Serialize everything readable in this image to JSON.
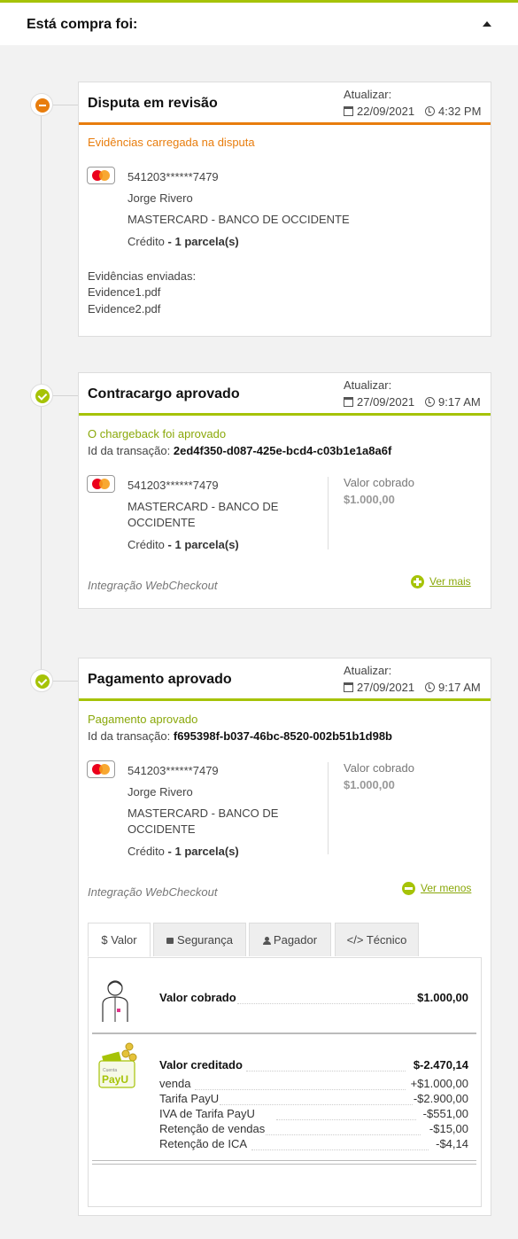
{
  "header": {
    "title": "Está compra foi:"
  },
  "colors": {
    "accent_green": "#a6c307",
    "accent_orange": "#e87d0d",
    "mastercard_red": "#eb001b",
    "mastercard_yellow": "#f79e1b"
  },
  "cards": [
    {
      "title": "Disputa em revisão",
      "status_icon": "minus-circle-icon",
      "update_label": "Atualizar:",
      "date": "22/09/2021",
      "time": "4:32 PM",
      "status": "Evidências carregada na disputa",
      "card_number": "541203******7479",
      "holder": "Jorge Rivero",
      "brand_bank": "MASTERCARD - BANCO DE OCCIDENTE",
      "credit_label": "Crédito",
      "installments": "- 1 parcela(s)",
      "evidence_label": "Evidências enviadas:",
      "evidence_files": [
        "Evidence1.pdf",
        "Evidence2.pdf"
      ]
    },
    {
      "title": "Contracargo aprovado",
      "status_icon": "check-circle-icon",
      "update_label": "Atualizar:",
      "date": "27/09/2021",
      "time": "9:17 AM",
      "status": "O chargeback foi aprovado",
      "tx_label": "Id da transação:",
      "tx_id": "2ed4f350-d087-425e-bcd4-c03b1e1a8a6f",
      "card_number": "541203******7479",
      "brand_bank_line1": "MASTERCARD - BANCO DE",
      "brand_bank_line2": "OCCIDENTE",
      "credit_label": "Crédito",
      "installments": "- 1 parcela(s)",
      "value_label": "Valor cobrado",
      "value": "$1.000,00",
      "integration": "Integração WebCheckout",
      "toggle": "Ver mais"
    },
    {
      "title": "Pagamento aprovado",
      "status_icon": "check-circle-icon",
      "update_label": "Atualizar:",
      "date": "27/09/2021",
      "time": "9:17 AM",
      "status": "Pagamento aprovado",
      "tx_label": "Id da transação:",
      "tx_id": "f695398f-b037-46bc-8520-002b51b1d98b",
      "card_number": "541203******7479",
      "holder": "Jorge Rivero",
      "brand_bank_line1": "MASTERCARD - BANCO DE",
      "brand_bank_line2": "OCCIDENTE",
      "credit_label": "Crédito",
      "installments": "- 1 parcela(s)",
      "value_label": "Valor cobrado",
      "value": "$1.000,00",
      "integration": "Integração WebCheckout",
      "toggle": "Ver menos",
      "tabs": [
        "$ Valor",
        "Segurança",
        "Pagador",
        "</> Técnico"
      ],
      "active_tab": "$ Valor",
      "charged": {
        "label": "Valor cobrado",
        "value": "$1.000,00"
      },
      "credited": {
        "label": "Valor creditado",
        "value": "$-2.470,14",
        "rows": [
          {
            "label": "venda",
            "value": "+$1.000,00"
          },
          {
            "label": "Tarifa PayU",
            "value": "-$2.900,00"
          },
          {
            "label": "IVA de Tarifa PayU",
            "value": "-$551,00"
          },
          {
            "label": "Retenção de vendas",
            "value": "-$15,00"
          },
          {
            "label": "Retenção de ICA",
            "value": "-$4,14"
          }
        ]
      },
      "payu_logo_small": "Cuenta",
      "payu_logo": "PayU"
    }
  ]
}
